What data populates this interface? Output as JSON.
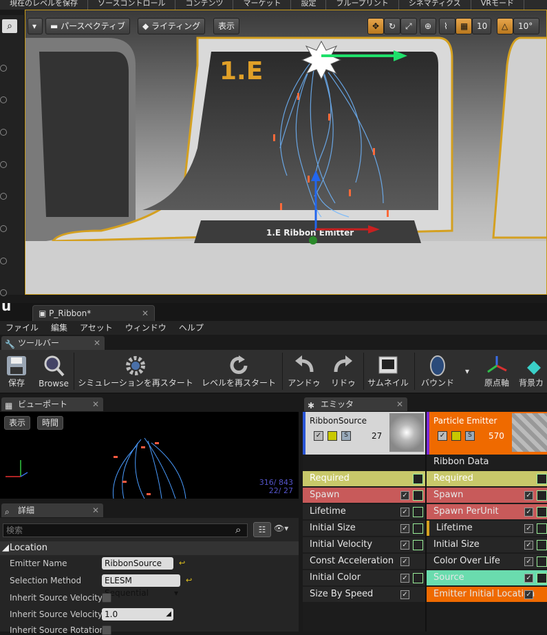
{
  "editor_menu": [
    "現在のレベルを保存",
    "ソースコントロール",
    "コンテンツ",
    "マーケット",
    "設定",
    "ブループリント",
    "シネマティクス",
    "VRモード"
  ],
  "viewport": {
    "perspective_label": "パースペクティブ",
    "lighting_label": "ライティング",
    "show_label": "表示",
    "snap_grid": "10",
    "snap_angle": "10°",
    "scene_label_left": "1.E",
    "platform_label": "1.E Ribbon Emitter"
  },
  "doc_tab": {
    "title": "P_Ribbon*"
  },
  "menubar": [
    "ファイル",
    "編集",
    "アセット",
    "ウィンドウ",
    "ヘルプ"
  ],
  "toolbar_tab": "ツールバー",
  "toolbar": {
    "save": "保存",
    "browse": "Browse",
    "restart_sim": "シミュレーションを再スタート",
    "restart_level": "レベルを再スタート",
    "undo": "アンドゥ",
    "redo": "リドゥ",
    "thumbnail": "サムネイル",
    "bounds": "バウンド",
    "origin_axis": "原点軸",
    "background": "背景カ"
  },
  "viewport_panel": {
    "tab": "ビューポート",
    "show": "表示",
    "time": "時間",
    "stat1": "316/ 843",
    "stat2": "22/  27"
  },
  "details_panel": {
    "tab": "詳細",
    "search_placeholder": "検索",
    "category": "Location",
    "props": {
      "emitter_name_label": "Emitter Name",
      "emitter_name_value": "RibbonSource",
      "selection_method_label": "Selection Method",
      "selection_method_value": "ELESM Sequential",
      "inherit_vel_label": "Inherit Source Velocity",
      "inherit_vel_scale_label": "Inherit Source Velocity Sc",
      "inherit_vel_scale_value": "1.0",
      "inherit_rot_label": "Inherit Source Rotation"
    }
  },
  "emitters_panel": {
    "tab": "エミッタ",
    "emitter1": {
      "name": "RibbonSource",
      "count": "27",
      "modules": [
        "Required",
        "Spawn",
        "Lifetime",
        "Initial Size",
        "Initial Velocity",
        "Const Acceleration",
        "Initial Color",
        "Size By Speed"
      ]
    },
    "emitter2": {
      "name": "Particle Emitter",
      "count": "570",
      "type_data": "Ribbon Data",
      "modules": [
        "Required",
        "Spawn",
        "Spawn PerUnit",
        "Lifetime",
        "Initial Size",
        "Color Over Life",
        "Source",
        "Emitter Initial Location"
      ]
    }
  },
  "colors": {
    "accent_orange": "#ef6a00",
    "required_yellow": "#c8c86a",
    "spawn_red": "#c85a5a",
    "source_teal": "#6adcae"
  }
}
